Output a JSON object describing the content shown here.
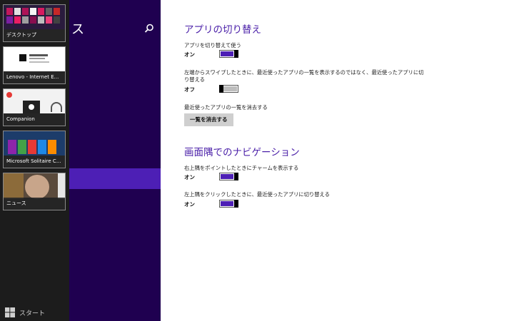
{
  "switcher": {
    "apps": [
      {
        "label": "デスクトップ"
      },
      {
        "label": "Lenovo - Internet E..."
      },
      {
        "label": "Companion"
      },
      {
        "label": "Microsoft Solitaire C..."
      },
      {
        "label": "ニュース"
      }
    ],
    "start_label": "スタート"
  },
  "leftpane": {
    "title_fragment": "ス"
  },
  "sections": {
    "switching": {
      "title": "アプリの切り替え",
      "settings": [
        {
          "label": "アプリを切り替えて使う",
          "state": "オン"
        },
        {
          "label": "左端からスワイプしたときに、最近使ったアプリの一覧を表示するのではなく、最近使ったアプリに切り替える",
          "state": "オフ"
        },
        {
          "label": "最近使ったアプリの一覧を消去する"
        }
      ],
      "clear_button": "一覧を消去する"
    },
    "corners": {
      "title": "画面隅でのナビゲーション",
      "settings": [
        {
          "label": "右上隅をポイントしたときにチャームを表示する",
          "state": "オン"
        },
        {
          "label": "左上隅をクリックしたときに、最近使ったアプリに切り替える",
          "state": "オン"
        }
      ]
    }
  },
  "colors": {
    "accent": "#4d1fb5",
    "pane_bg": "#1f0050",
    "heading": "#4a1fa8"
  }
}
